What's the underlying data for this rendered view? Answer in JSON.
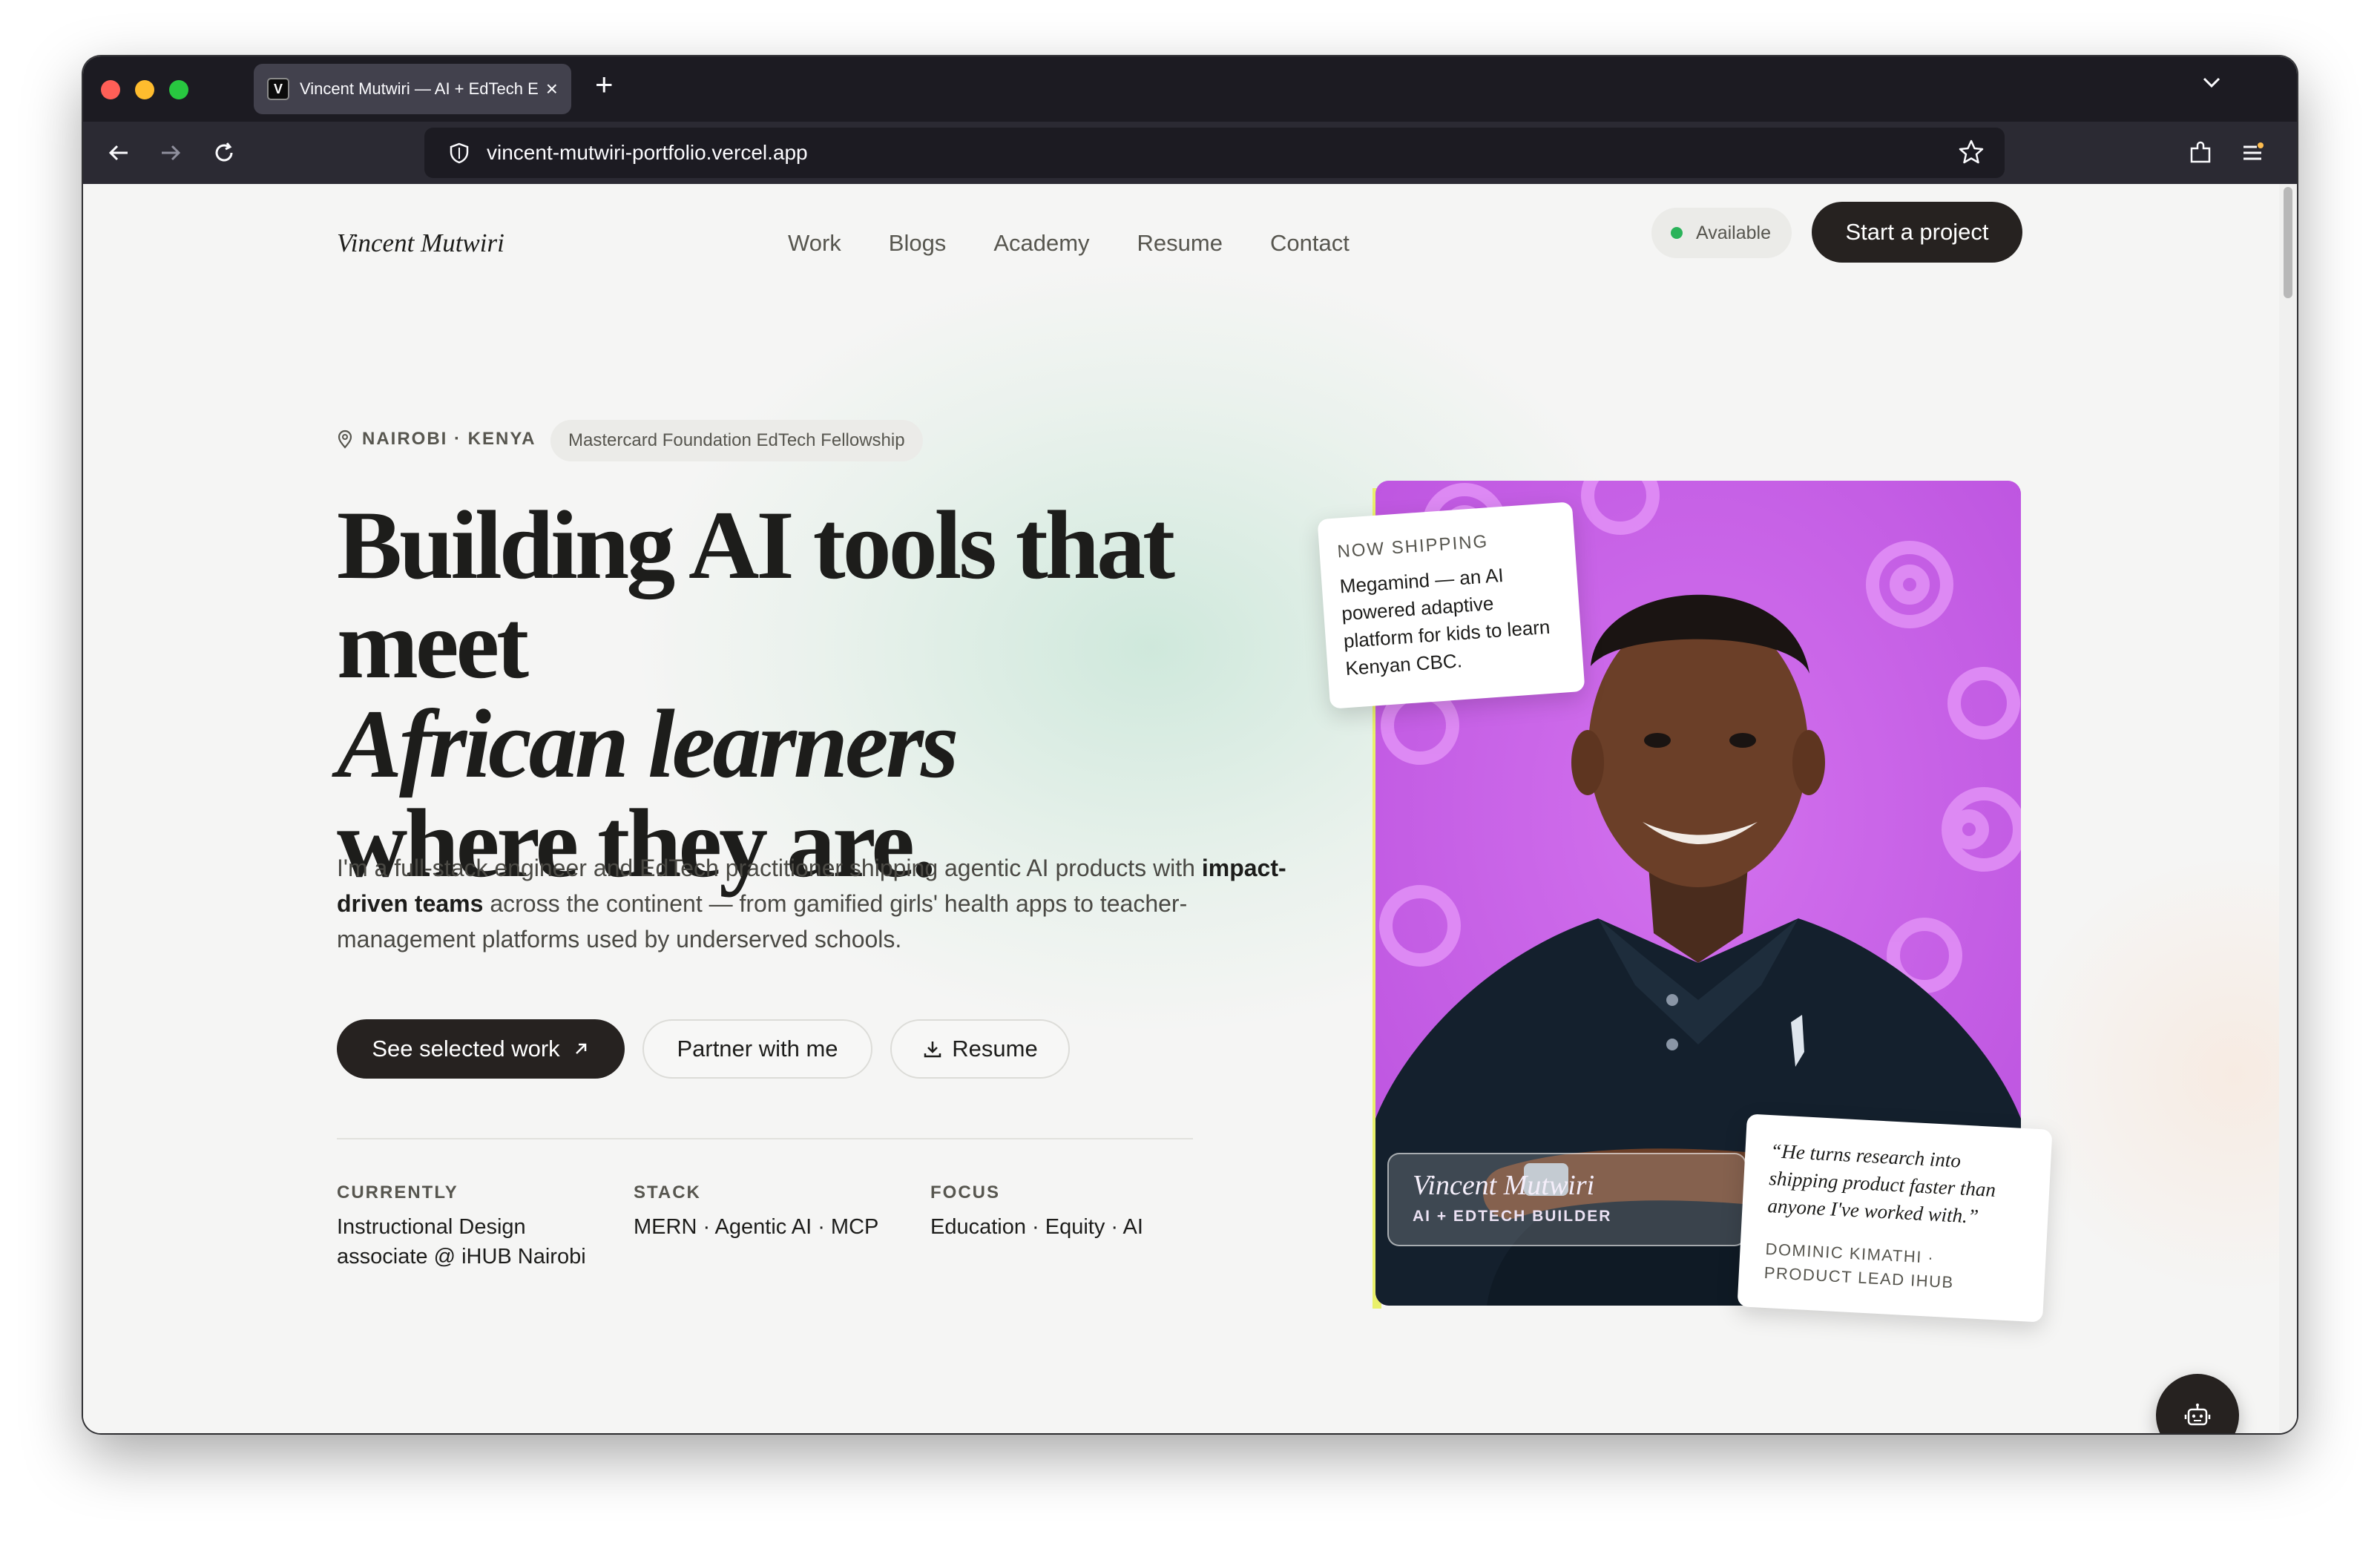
{
  "browser": {
    "tab_title": "Vincent Mutwiri — AI + EdTech E",
    "tab_favicon": "V",
    "url": "vincent-mutwiri-portfolio.vercel.app"
  },
  "site": {
    "logo": "Vincent Mutwiri",
    "nav": [
      "Work",
      "Blogs",
      "Academy",
      "Resume",
      "Contact"
    ],
    "available": "Available",
    "cta": "Start a project"
  },
  "hero": {
    "location": "NAIROBI · KENYA",
    "fellowship": "Mastercard Foundation EdTech Fellowship",
    "headline_1": "Building AI tools that meet",
    "headline_2": "African learners",
    "headline_3": "where they are.",
    "bio_1": "I'm a full-stack engineer and EdTech practitioner shipping agentic AI products with",
    "bio_bold": "impact-driven teams",
    "bio_2": "across the continent — from gamified girls' health apps to teacher-management platforms used by underserved schools.",
    "btn_work": "See selected work",
    "btn_partner": "Partner with me",
    "btn_resume": "Resume"
  },
  "meta": [
    {
      "label": "CURRENTLY",
      "value": "Instructional Design associate @ iHUB Nairobi"
    },
    {
      "label": "STACK",
      "value": "MERN · Agentic AI · MCP"
    },
    {
      "label": "FOCUS",
      "value": "Education · Equity · AI"
    }
  ],
  "portrait": {
    "name": "Vincent Mutwiri",
    "role": "AI + EDTECH BUILDER",
    "shipping_label": "NOW SHIPPING",
    "shipping_text": "Megamind — an AI powered adaptive platform for kids to learn Kenyan CBC.",
    "quote": "“He turns research into shipping product faster than anyone I've worked with.”",
    "quote_author": "DOMINIC KIMATHI · PRODUCT LEAD IHUB"
  },
  "colors": {
    "accent_dark": "#262220",
    "portrait_bg": "#c660e6",
    "available_dot": "#2bb35a"
  }
}
